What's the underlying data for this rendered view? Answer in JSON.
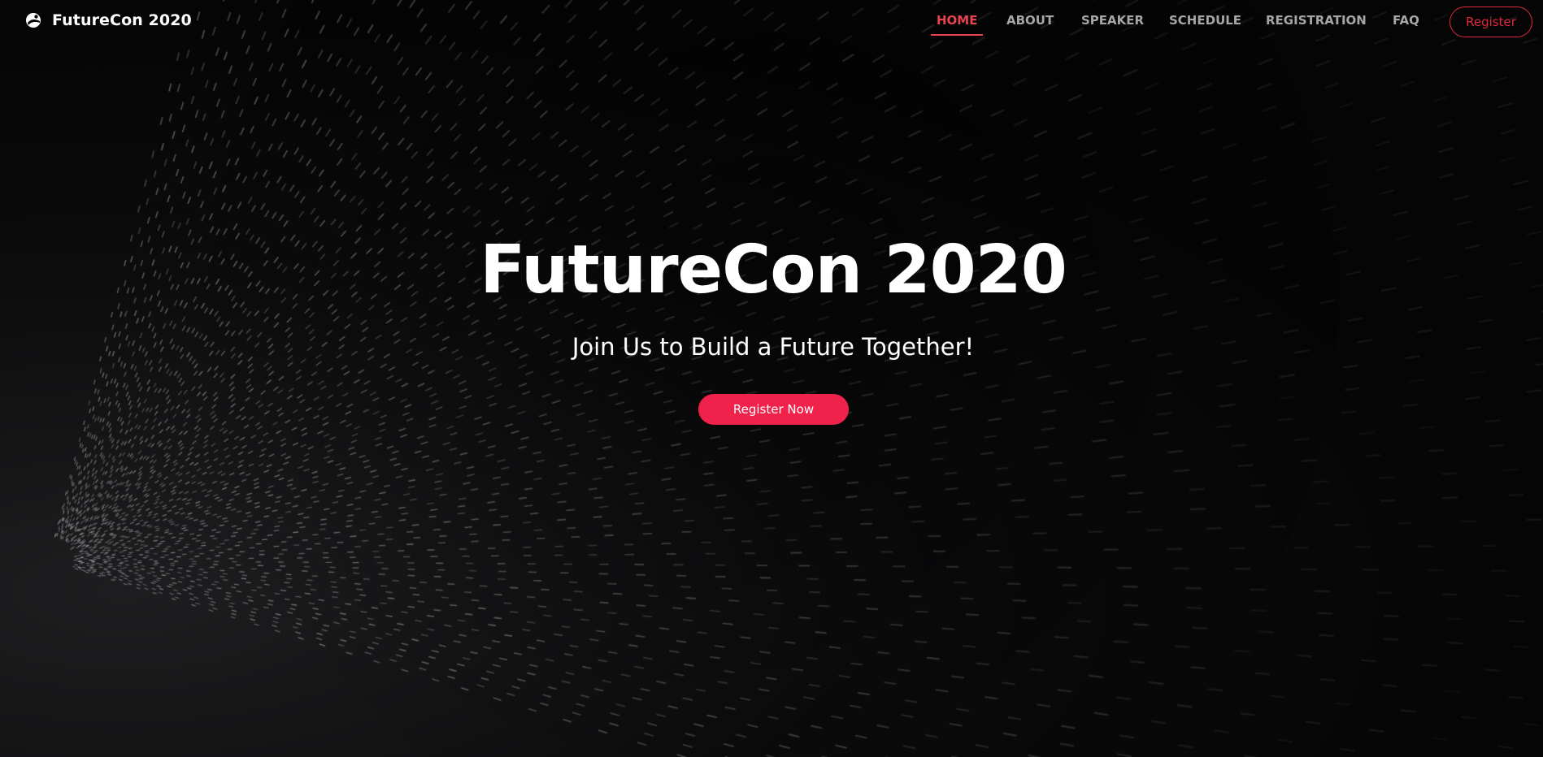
{
  "brand": {
    "name": "FutureCon 2020",
    "icon": "planet-icon"
  },
  "nav": {
    "items": [
      {
        "label": "HOME",
        "active": true
      },
      {
        "label": "ABOUT",
        "active": false
      },
      {
        "label": "SPEAKER",
        "active": false
      },
      {
        "label": "SCHEDULE",
        "active": false
      },
      {
        "label": "REGISTRATION",
        "active": false
      },
      {
        "label": "FAQ",
        "active": false
      }
    ],
    "register_label": "Register"
  },
  "hero": {
    "title": "FutureCon 2020",
    "subtitle": "Join Us to Build a Future Together!",
    "cta_label": "Register Now"
  },
  "colors": {
    "accent": "#f0214a",
    "nav_active": "#e8434f",
    "nav_inactive": "#a6a6a6",
    "background": "#050506"
  }
}
